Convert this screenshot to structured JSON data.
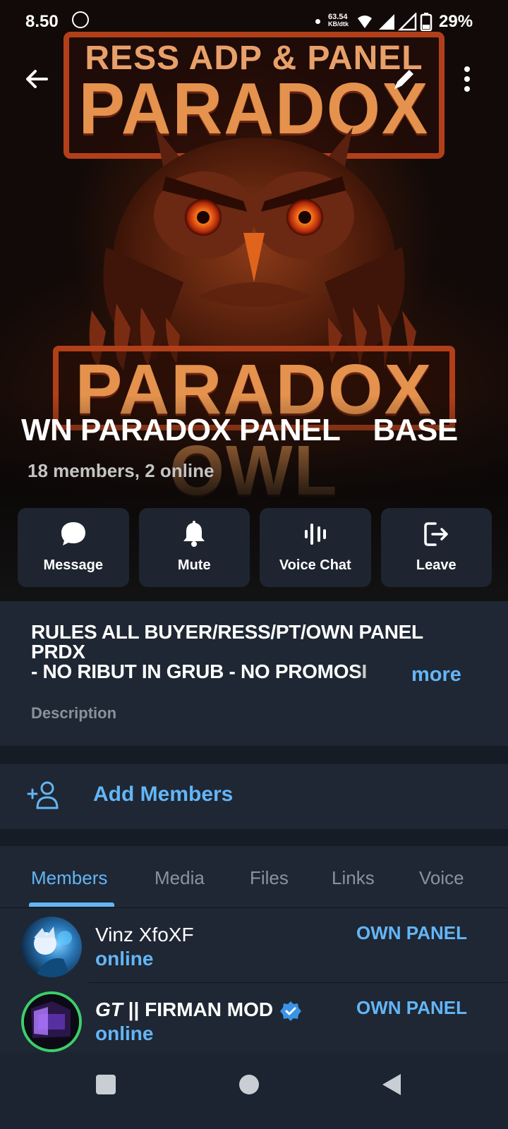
{
  "status_bar": {
    "time": "8.50",
    "net_speed": "63.54",
    "net_unit": "KB/dtk",
    "battery": "29%"
  },
  "header": {
    "banner_top_line": "RESS ADP & PANEL",
    "banner_title": "PARADOX OWL",
    "banner_bottom_title": "PARADOX OWL",
    "group_title": "WN PARADOX PANEL    BASE",
    "group_subtitle": "18 members, 2 online"
  },
  "actions": [
    {
      "label": "Message",
      "icon": "chat-bubble-icon"
    },
    {
      "label": "Mute",
      "icon": "bell-icon"
    },
    {
      "label": "Voice Chat",
      "icon": "voice-chat-icon"
    },
    {
      "label": "Leave",
      "icon": "leave-icon"
    }
  ],
  "description": {
    "line1": "RULES ALL BUYER/RESS/PT/OWN PANEL",
    "line2": "PRDX",
    "line3": "- NO RIBUT IN GRUB - NO PROMOSI",
    "more": "more",
    "label": "Description"
  },
  "add_members": {
    "label": "Add Members"
  },
  "tabs": [
    "Members",
    "Media",
    "Files",
    "Links",
    "Voice"
  ],
  "members": [
    {
      "name": "Vinz XfoXF",
      "status": "online",
      "role": "OWN PANEL"
    },
    {
      "name_prefix": "GT",
      "name": " || FIRMAN MOD",
      "status": "online",
      "role": "OWN PANEL",
      "verified": true
    }
  ],
  "colors": {
    "accent": "#64b5f6",
    "card": "#1e2733",
    "owl_orange": "#e4924d"
  }
}
